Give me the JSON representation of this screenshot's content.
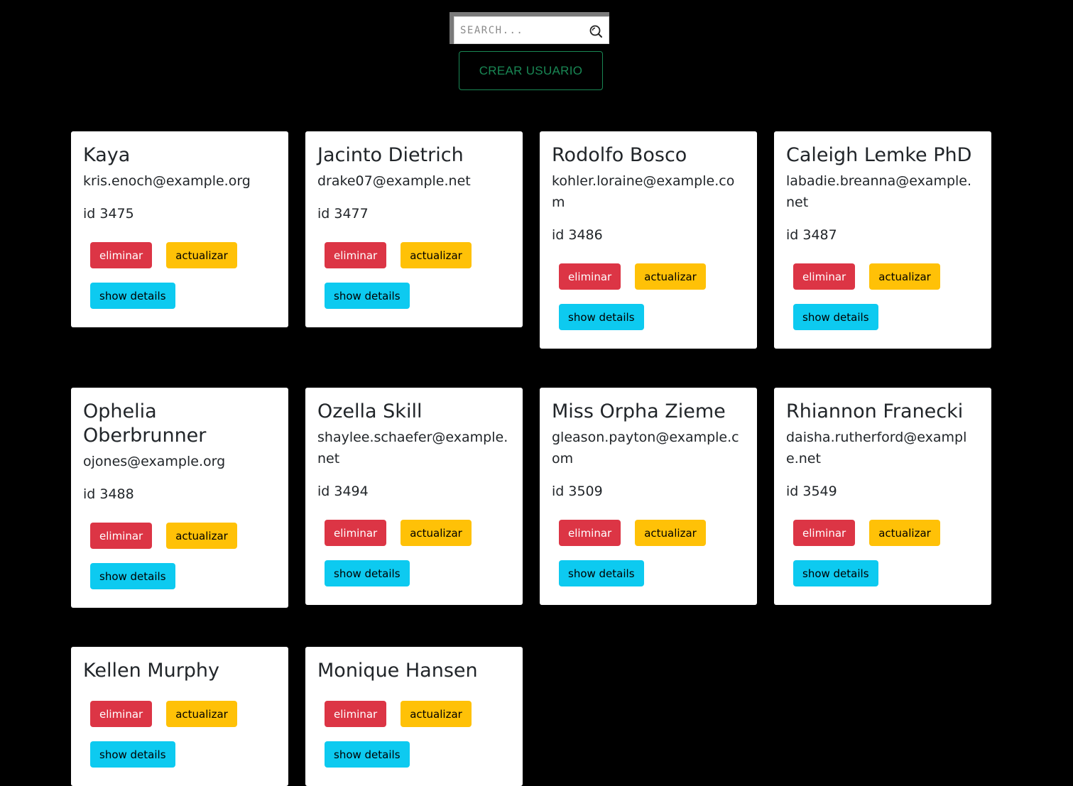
{
  "search": {
    "placeholder": "SEARCH...",
    "icon": "search-refresh-icon"
  },
  "create_button": {
    "label": "CREAR USUARIO",
    "color": "#198754"
  },
  "buttons": {
    "delete_label": "eliminar",
    "update_label": "actualizar",
    "details_label": "show details",
    "delete_color": "#dc3545",
    "update_color": "#ffc107",
    "details_color": "#0dcaf0"
  },
  "users": [
    {
      "name": "Kaya",
      "email": "kris.enoch@example.org",
      "id_text": "id 3475"
    },
    {
      "name": "Jacinto Dietrich",
      "email": "drake07@example.net",
      "id_text": "id 3477"
    },
    {
      "name": "Rodolfo Bosco",
      "email": "kohler.loraine@example.com",
      "id_text": "id 3486"
    },
    {
      "name": "Caleigh Lemke PhD",
      "email": "labadie.breanna@example.net",
      "id_text": "id 3487"
    },
    {
      "name": "Ophelia Oberbrunner",
      "email": "ojones@example.org",
      "id_text": "id 3488"
    },
    {
      "name": "Ozella Skill",
      "email": "shaylee.schaefer@example.net",
      "id_text": "id 3494"
    },
    {
      "name": "Miss Orpha Zieme",
      "email": "gleason.payton@example.com",
      "id_text": "id 3509"
    },
    {
      "name": "Rhiannon Franecki",
      "email": "daisha.rutherford@example.net",
      "id_text": "id 3549"
    },
    {
      "name": "Kellen Murphy",
      "email": "",
      "id_text": ""
    },
    {
      "name": "Monique Hansen",
      "email": "",
      "id_text": ""
    }
  ]
}
